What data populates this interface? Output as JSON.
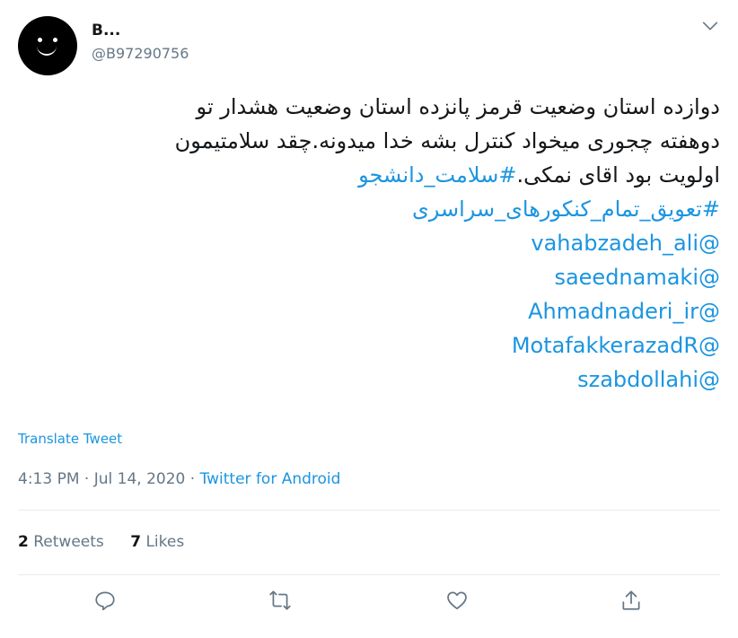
{
  "author": {
    "display_name": "B...",
    "handle": "@B97290756"
  },
  "tweet": {
    "lines": [
      {
        "text": "دوازده استان وضعیت قرمز  پانزده استان وضعیت هشدار تو",
        "type": "text"
      },
      {
        "text": "دوهفته چجوری میخواد کنترل بشه خدا میدونه.چقد سلامتیمون",
        "type": "text"
      },
      {
        "text": "اولویت بود اقای نمکی.",
        "type": "text",
        "hashtag": "#سلامت_دانشجو"
      },
      {
        "text": "#تعویق_تمام_کنکورهای_سراسری",
        "type": "link"
      },
      {
        "text": "@vahabzadeh_ali",
        "type": "link"
      },
      {
        "text": "@saeednamaki",
        "type": "link"
      },
      {
        "text": "@Ahmadnaderi_ir",
        "type": "link"
      },
      {
        "text": "@MotafakkerazadR",
        "type": "link"
      },
      {
        "text": "@szabdollahi",
        "type": "link"
      }
    ]
  },
  "translate_label": "Translate Tweet",
  "meta": {
    "time": "4:13 PM",
    "separator1": "·",
    "date": "Jul 14, 2020",
    "separator2": "·",
    "source": "Twitter for Android"
  },
  "stats": {
    "retweets_count": "2",
    "retweets_label": "Retweets",
    "likes_count": "7",
    "likes_label": "Likes"
  },
  "icons": {
    "more": "chevron-down-icon",
    "reply": "reply-icon",
    "retweet": "retweet-icon",
    "like": "heart-icon",
    "share": "share-icon"
  },
  "colors": {
    "link": "#1b95e0",
    "secondary_text": "#657786",
    "icon": "#657786"
  }
}
